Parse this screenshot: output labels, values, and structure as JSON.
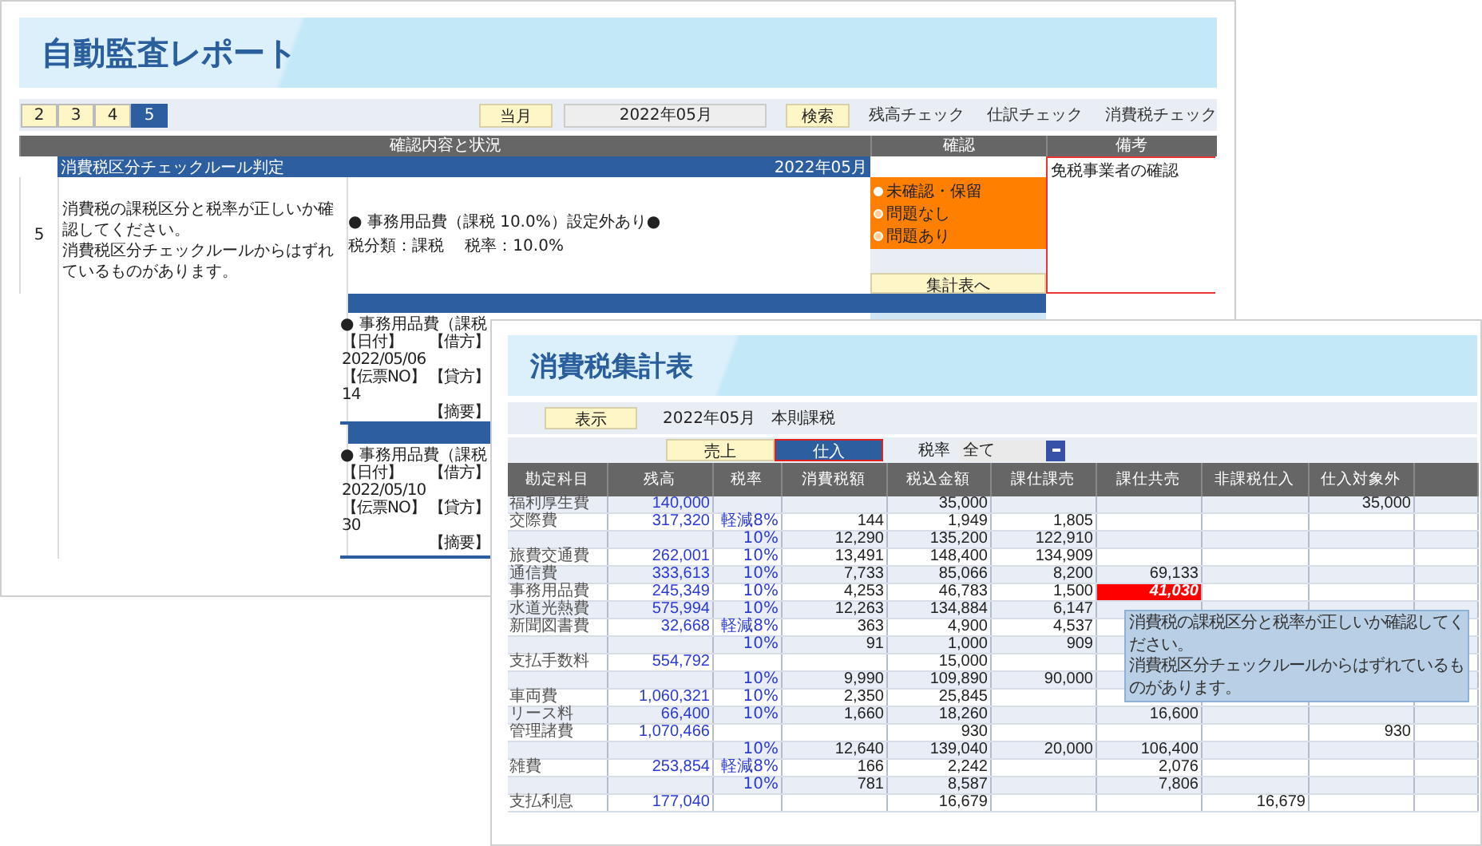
{
  "report_window": {
    "title": "自動監査レポート",
    "page_tabs": [
      {
        "label": "2",
        "selected": false
      },
      {
        "label": "3",
        "selected": false
      },
      {
        "label": "4",
        "selected": false
      },
      {
        "label": "5",
        "selected": true
      }
    ],
    "month_button": "当月",
    "month_field": "2022年05月",
    "search_button": "検索",
    "check_links": [
      "残高チェック",
      "仕訳チェック",
      "消費税チェック"
    ],
    "columns": [
      "確認内容と状況",
      "確認",
      "備考"
    ],
    "rule": {
      "number": "5",
      "title": "消費税区分チェックルール判定",
      "period": "2022年05月",
      "description_lines": [
        "消費税の課税区分と税率が正しいか確認してください。",
        "消費税区分チェックルールからはずれているものがあります。"
      ],
      "finding_heading": "● 事務用品費（課税 10.0%）設定外あり●",
      "finding_detail": "税分類：課税　 税率：10.0%",
      "confirm_options": [
        {
          "label": "未確認・保留",
          "selected": true
        },
        {
          "label": "問題なし",
          "selected": false
        },
        {
          "label": "問題あり",
          "selected": false
        }
      ],
      "summary_button": "集計表へ",
      "remarks": "免税事業者の確認"
    },
    "entries": [
      {
        "heading": "● 事務用品費（課税",
        "date_label": "【日付】",
        "debit_label": "【借方】",
        "date": "2022/05/06",
        "slip_label": "【伝票NO】",
        "credit_label": "【貸方】",
        "slip_no": "14",
        "memo_label": "【摘要】"
      },
      {
        "heading": "● 事務用品費（課税",
        "date_label": "【日付】",
        "debit_label": "【借方】",
        "date": "2022/05/10",
        "slip_label": "【伝票NO】",
        "credit_label": "【貸方】",
        "slip_no": "30",
        "memo_label": "【摘要】"
      }
    ]
  },
  "summary_window": {
    "title": "消費税集計表",
    "show_button": "表示",
    "period_text": "2022年05月　本則課税",
    "toggles": [
      {
        "label": "売上",
        "selected": false
      },
      {
        "label": "仕入",
        "selected": true
      }
    ],
    "rate_label": "税率",
    "rate_select": "全て",
    "columns": [
      "勘定科目",
      "残高",
      "税率",
      "消費税額",
      "税込金額",
      "課仕課売",
      "課仕共売",
      "非課税仕入",
      "仕入対象外"
    ],
    "rows": [
      {
        "account": "福利厚生費",
        "balance": "140,000",
        "gross": "35,000",
        "excluded": "35,000"
      },
      {
        "account": "交際費",
        "balance": "317,320",
        "rate": "軽減8%",
        "tax": "144",
        "gross": "1,949",
        "taxable_sales": "1,805"
      },
      {
        "rate": "10%",
        "tax": "12,290",
        "gross": "135,200",
        "taxable_sales": "122,910"
      },
      {
        "account": "旅費交通費",
        "balance": "262,001",
        "rate": "10%",
        "tax": "13,491",
        "gross": "148,400",
        "taxable_sales": "134,909"
      },
      {
        "account": "通信費",
        "balance": "333,613",
        "rate": "10%",
        "tax": "7,733",
        "gross": "85,066",
        "taxable_sales": "8,200",
        "common_sales": "69,133"
      },
      {
        "account": "事務用品費",
        "balance": "245,349",
        "rate": "10%",
        "tax": "4,253",
        "gross": "46,783",
        "taxable_sales": "1,500",
        "common_sales": "41,030",
        "alert": true
      },
      {
        "account": "水道光熱費",
        "balance": "575,994",
        "rate": "10%",
        "tax": "12,263",
        "gross": "134,884",
        "taxable_sales": "6,147"
      },
      {
        "account": "新聞図書費",
        "balance": "32,668",
        "rate": "軽減8%",
        "tax": "363",
        "gross": "4,900",
        "taxable_sales": "4,537"
      },
      {
        "rate": "10%",
        "tax": "91",
        "gross": "1,000",
        "taxable_sales": "909"
      },
      {
        "account": "支払手数料",
        "balance": "554,792",
        "gross": "15,000"
      },
      {
        "rate": "10%",
        "tax": "9,990",
        "gross": "109,890",
        "taxable_sales": "90,000"
      },
      {
        "account": "車両費",
        "balance": "1,060,321",
        "rate": "10%",
        "tax": "2,350",
        "gross": "25,845"
      },
      {
        "account": "リース料",
        "balance": "66,400",
        "rate": "10%",
        "tax": "1,660",
        "gross": "18,260",
        "common_sales": "16,600"
      },
      {
        "account": "管理諸費",
        "balance": "1,070,466",
        "gross": "930",
        "excluded": "930"
      },
      {
        "rate": "10%",
        "tax": "12,640",
        "gross": "139,040",
        "taxable_sales": "20,000",
        "common_sales": "106,400"
      },
      {
        "account": "雑費",
        "balance": "253,854",
        "rate": "軽減8%",
        "tax": "166",
        "gross": "2,242",
        "common_sales": "2,076"
      },
      {
        "rate": "10%",
        "tax": "781",
        "gross": "8,587",
        "common_sales": "7,806"
      },
      {
        "account": "支払利息",
        "balance": "177,040",
        "gross": "16,679",
        "non_taxable": "16,679"
      }
    ],
    "tooltip_lines": [
      "消費税の課税区分と税率が正しいか確認してください。",
      "消費税区分チェックルールからはずれているものがあります。"
    ]
  }
}
